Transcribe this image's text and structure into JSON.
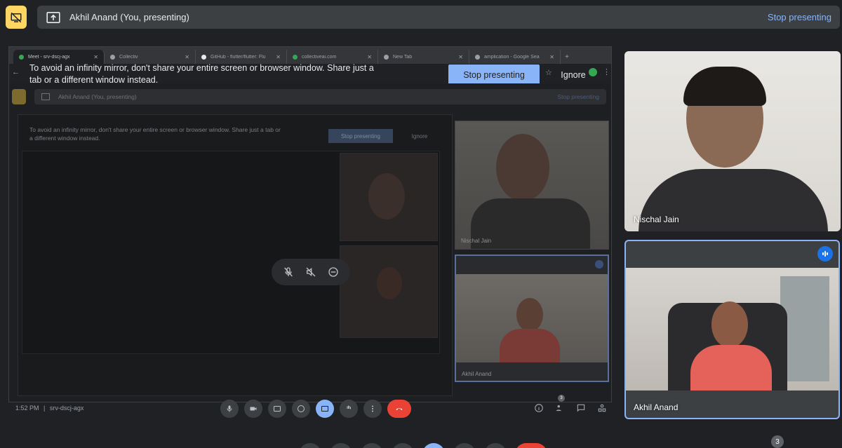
{
  "presenting_bar": {
    "title": "Akhil Anand (You, presenting)",
    "stop_label": "Stop presenting"
  },
  "browser_tabs": [
    {
      "label": "Meet - srv-dscj-agx",
      "icon": "meet-icon"
    },
    {
      "label": "Collectiv",
      "icon": "site-icon"
    },
    {
      "label": "GitHub - flutter/flutter: Flu",
      "icon": "github-icon"
    },
    {
      "label": "collectiveai.com",
      "icon": "site-icon"
    },
    {
      "label": "New Tab",
      "icon": "globe-icon"
    },
    {
      "label": "amplication - Google Sea",
      "icon": "google-icon"
    }
  ],
  "mirror_banner": {
    "message": "To avoid an infinity mirror, don't share your entire screen or browser window. Share just a tab or a different window instead.",
    "stop_label": "Stop presenting",
    "ignore_label": "Ignore"
  },
  "nested": {
    "presenting_title": "Akhil Anand (You, presenting)",
    "stop_label": "Stop presenting",
    "message": "To avoid an infinity mirror, don't share your entire screen or browser window. Share just a tab or a different window instead.",
    "ignore_label": "Ignore",
    "tile_names": [
      "Nischal Jain",
      "Akhil Anand"
    ]
  },
  "participants": [
    {
      "name": "Nischal Jain",
      "speaking": false
    },
    {
      "name": "Akhil Anand",
      "speaking": true
    }
  ],
  "meeting": {
    "time": "1:52 PM",
    "separator": "|",
    "code": "srv-dscj-agx",
    "participant_count": "3",
    "small_participant_count": "3"
  },
  "colors": {
    "accent": "#8ab4f8",
    "presenting_off": "#fdd663",
    "end_call": "#ea4335",
    "speaking": "#1a73e8"
  }
}
